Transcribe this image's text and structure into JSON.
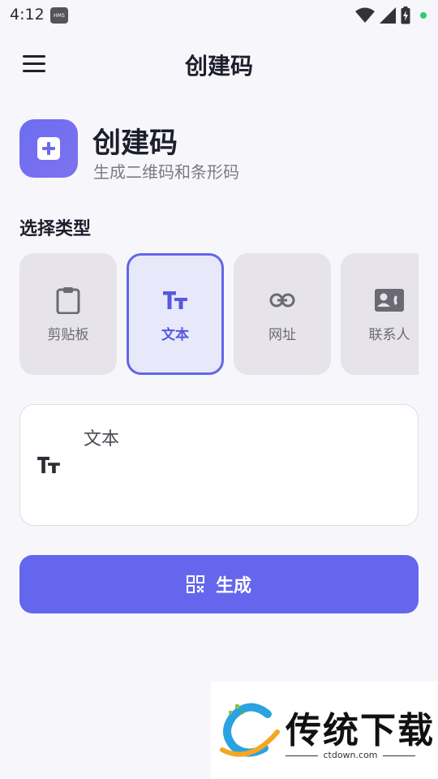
{
  "status_bar": {
    "time": "4:12",
    "hms_badge": "HMS",
    "icons": [
      "wifi-icon",
      "signal-icon",
      "battery-charging-icon",
      "notification-dot"
    ]
  },
  "app_bar": {
    "title": "创建码",
    "menu_icon": "menu-icon"
  },
  "header": {
    "icon": "add-square-icon",
    "title": "创建码",
    "subtitle": "生成二维码和条形码"
  },
  "type_section": {
    "label": "选择类型",
    "types": [
      {
        "label": "剪贴板",
        "icon": "clipboard-icon",
        "selected": false
      },
      {
        "label": "文本",
        "icon": "text-icon",
        "selected": true
      },
      {
        "label": "网址",
        "icon": "link-icon",
        "selected": false
      },
      {
        "label": "联系人",
        "icon": "contact-card-icon",
        "selected": false
      }
    ]
  },
  "input": {
    "label": "文本",
    "icon": "text-icon"
  },
  "generate_button": {
    "label": "生成",
    "icon": "qr-code-icon"
  },
  "watermark": {
    "name": "传统下载",
    "url": "ctdown.com"
  },
  "colors": {
    "accent": "#6466ee",
    "selected_card_bg": "#e8e8fb",
    "card_bg": "#e6e3ea",
    "background": "#f7f7fb"
  }
}
